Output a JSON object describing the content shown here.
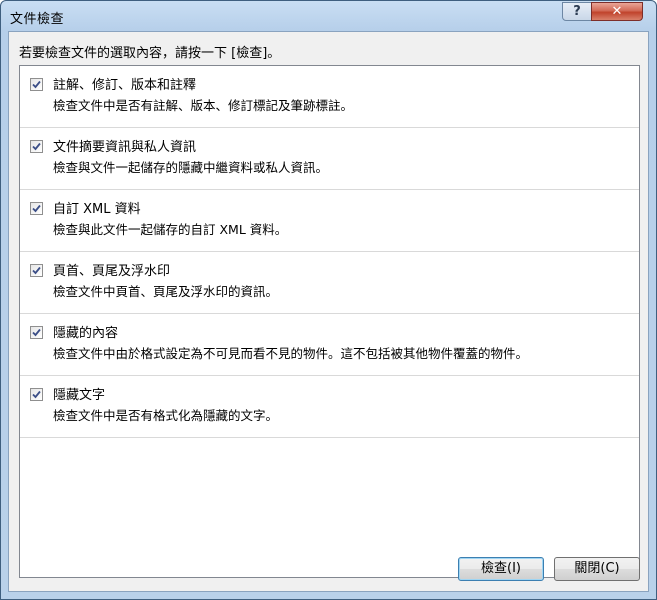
{
  "window": {
    "title": "文件檢查",
    "help_glyph": "?",
    "close_glyph": "✕"
  },
  "prompt": "若要檢查文件的選取內容，請按一下 [檢查]。",
  "items": [
    {
      "title": "註解、修訂、版本和註釋",
      "description": "檢查文件中是否有註解、版本、修訂標記及筆跡標註。",
      "checked": true
    },
    {
      "title": "文件摘要資訊與私人資訊",
      "description": "檢查與文件一起儲存的隱藏中繼資料或私人資訊。",
      "checked": true
    },
    {
      "title": "自訂 XML 資料",
      "description": "檢查與此文件一起儲存的自訂 XML 資料。",
      "checked": true
    },
    {
      "title": "頁首、頁尾及浮水印",
      "description": "檢查文件中頁首、頁尾及浮水印的資訊。",
      "checked": true
    },
    {
      "title": "隱藏的內容",
      "description": "檢查文件中由於格式設定為不可見而看不見的物件。這不包括被其他物件覆蓋的物件。",
      "checked": true
    },
    {
      "title": "隱藏文字",
      "description": "檢查文件中是否有格式化為隱藏的文字。",
      "checked": true
    }
  ],
  "buttons": {
    "inspect_label": "檢查(I)",
    "close_label": "關閉(C)"
  },
  "colors": {
    "frame": "#b9d1ea",
    "client": "#f0f0f0",
    "close_button": "#c0432c"
  }
}
